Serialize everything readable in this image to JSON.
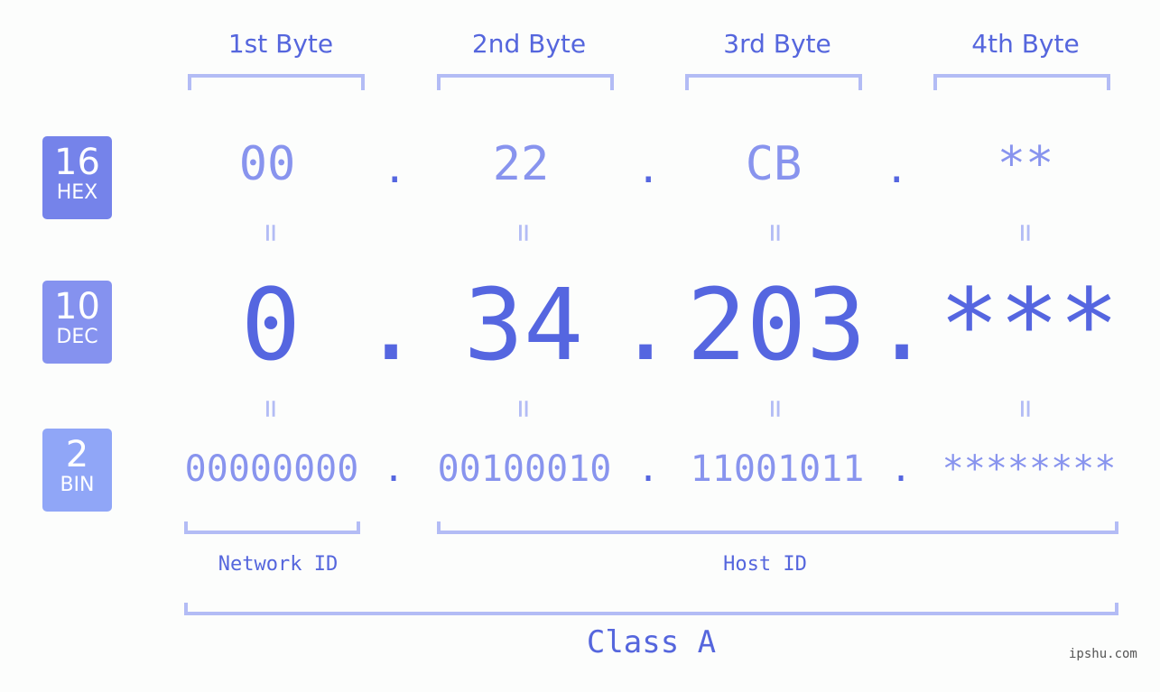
{
  "byte_headers": [
    "1st Byte",
    "2nd Byte",
    "3rd Byte",
    "4th Byte"
  ],
  "bases": [
    {
      "num": "16",
      "label": "HEX",
      "color": "#7583ea"
    },
    {
      "num": "10",
      "label": "DEC",
      "color": "#8592ef"
    },
    {
      "num": "2",
      "label": "BIN",
      "color": "#90a6f7"
    }
  ],
  "hex": [
    "00",
    "22",
    "CB",
    "**"
  ],
  "dec": [
    "0",
    "34",
    "203",
    "***"
  ],
  "bin": [
    "00000000",
    "00100010",
    "11001011",
    "********"
  ],
  "separator": ".",
  "equals": "=",
  "network_id_label": "Network ID",
  "host_id_label": "Host ID",
  "class_label": "Class A",
  "watermark": "ipshu.com"
}
